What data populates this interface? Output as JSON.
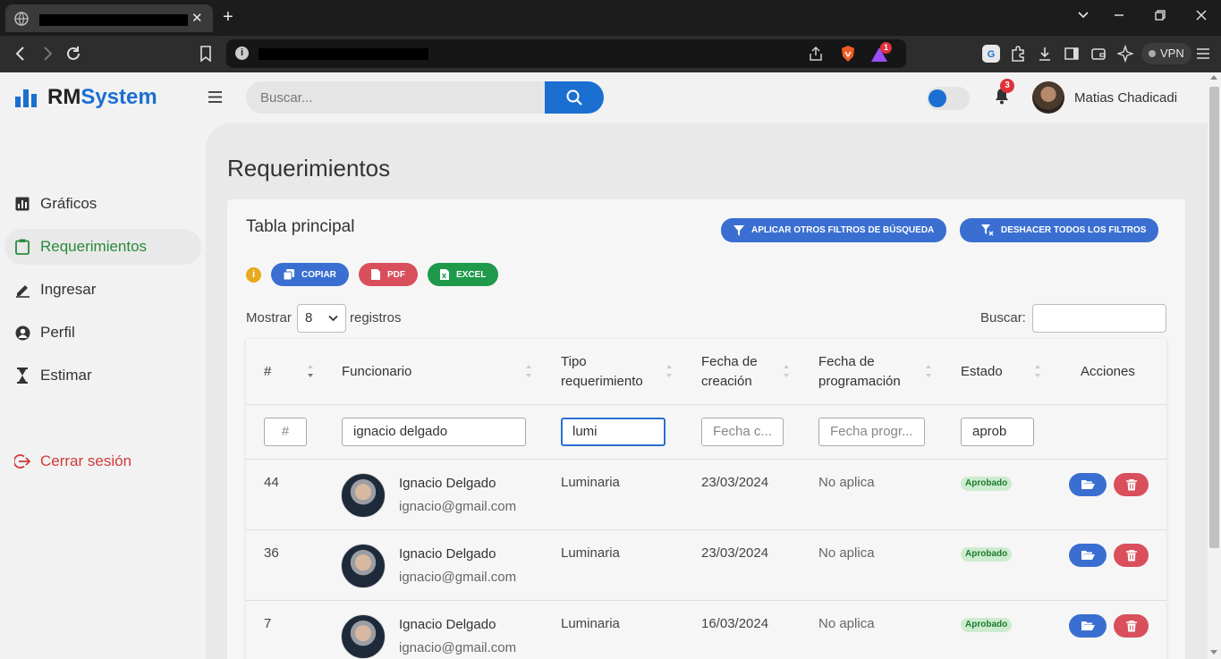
{
  "browser": {
    "vpn_label": "VPN",
    "notif_count": "1"
  },
  "header": {
    "logo_rm": "RM",
    "logo_system": "System",
    "search_placeholder": "Buscar...",
    "notification_count": "3",
    "user_name": "Matias Chadicadi"
  },
  "sidebar": {
    "items": [
      {
        "label": "Gráficos",
        "icon": "bar-chart-icon"
      },
      {
        "label": "Requerimientos",
        "icon": "clipboard-icon",
        "active": true
      },
      {
        "label": "Ingresar",
        "icon": "pen-icon"
      },
      {
        "label": "Perfil",
        "icon": "user-circle-icon"
      },
      {
        "label": "Estimar",
        "icon": "hourglass-icon"
      }
    ],
    "logout_label": "Cerrar sesión"
  },
  "main": {
    "page_title": "Requerimientos",
    "card_title": "Tabla principal",
    "apply_filters_label": "APLICAR OTROS FILTROS DE BÚSQUEDA",
    "clear_filters_label": "DESHACER TODOS LOS FILTROS",
    "copy_label": "COPIAR",
    "pdf_label": "PDF",
    "excel_label": "EXCEL",
    "show_label": "Mostrar",
    "page_length": "8",
    "records_label": "registros",
    "search_label": "Buscar:"
  },
  "table": {
    "headers": {
      "id": "#",
      "funcionario": "Funcionario",
      "tipo_1": "Tipo",
      "tipo_2": "requerimiento",
      "creacion_1": "Fecha de",
      "creacion_2": "creación",
      "programacion_1": "Fecha de",
      "programacion_2": "programación",
      "estado": "Estado",
      "acciones": "Acciones"
    },
    "filters": {
      "id_placeholder": "#",
      "funcionario_value": "ignacio delgado",
      "tipo_value": "lumi",
      "creacion_placeholder": "Fecha c...",
      "programacion_placeholder": "Fecha progr...",
      "estado_value": "aprob"
    },
    "rows": [
      {
        "id": "44",
        "name": "Ignacio Delgado",
        "email": "ignacio@gmail.com",
        "tipo": "Luminaria",
        "creacion": "23/03/2024",
        "programacion": "No aplica",
        "estado": "Aprobado"
      },
      {
        "id": "36",
        "name": "Ignacio Delgado",
        "email": "ignacio@gmail.com",
        "tipo": "Luminaria",
        "creacion": "23/03/2024",
        "programacion": "No aplica",
        "estado": "Aprobado"
      },
      {
        "id": "7",
        "name": "Ignacio Delgado",
        "email": "ignacio@gmail.com",
        "tipo": "Luminaria",
        "creacion": "16/03/2024",
        "programacion": "No aplica",
        "estado": "Aprobado"
      }
    ]
  },
  "colors": {
    "accent": "#1a6fd1",
    "active_nav": "#2a8a3a",
    "danger": "#d94f5c",
    "success": "#1e9a4a"
  }
}
